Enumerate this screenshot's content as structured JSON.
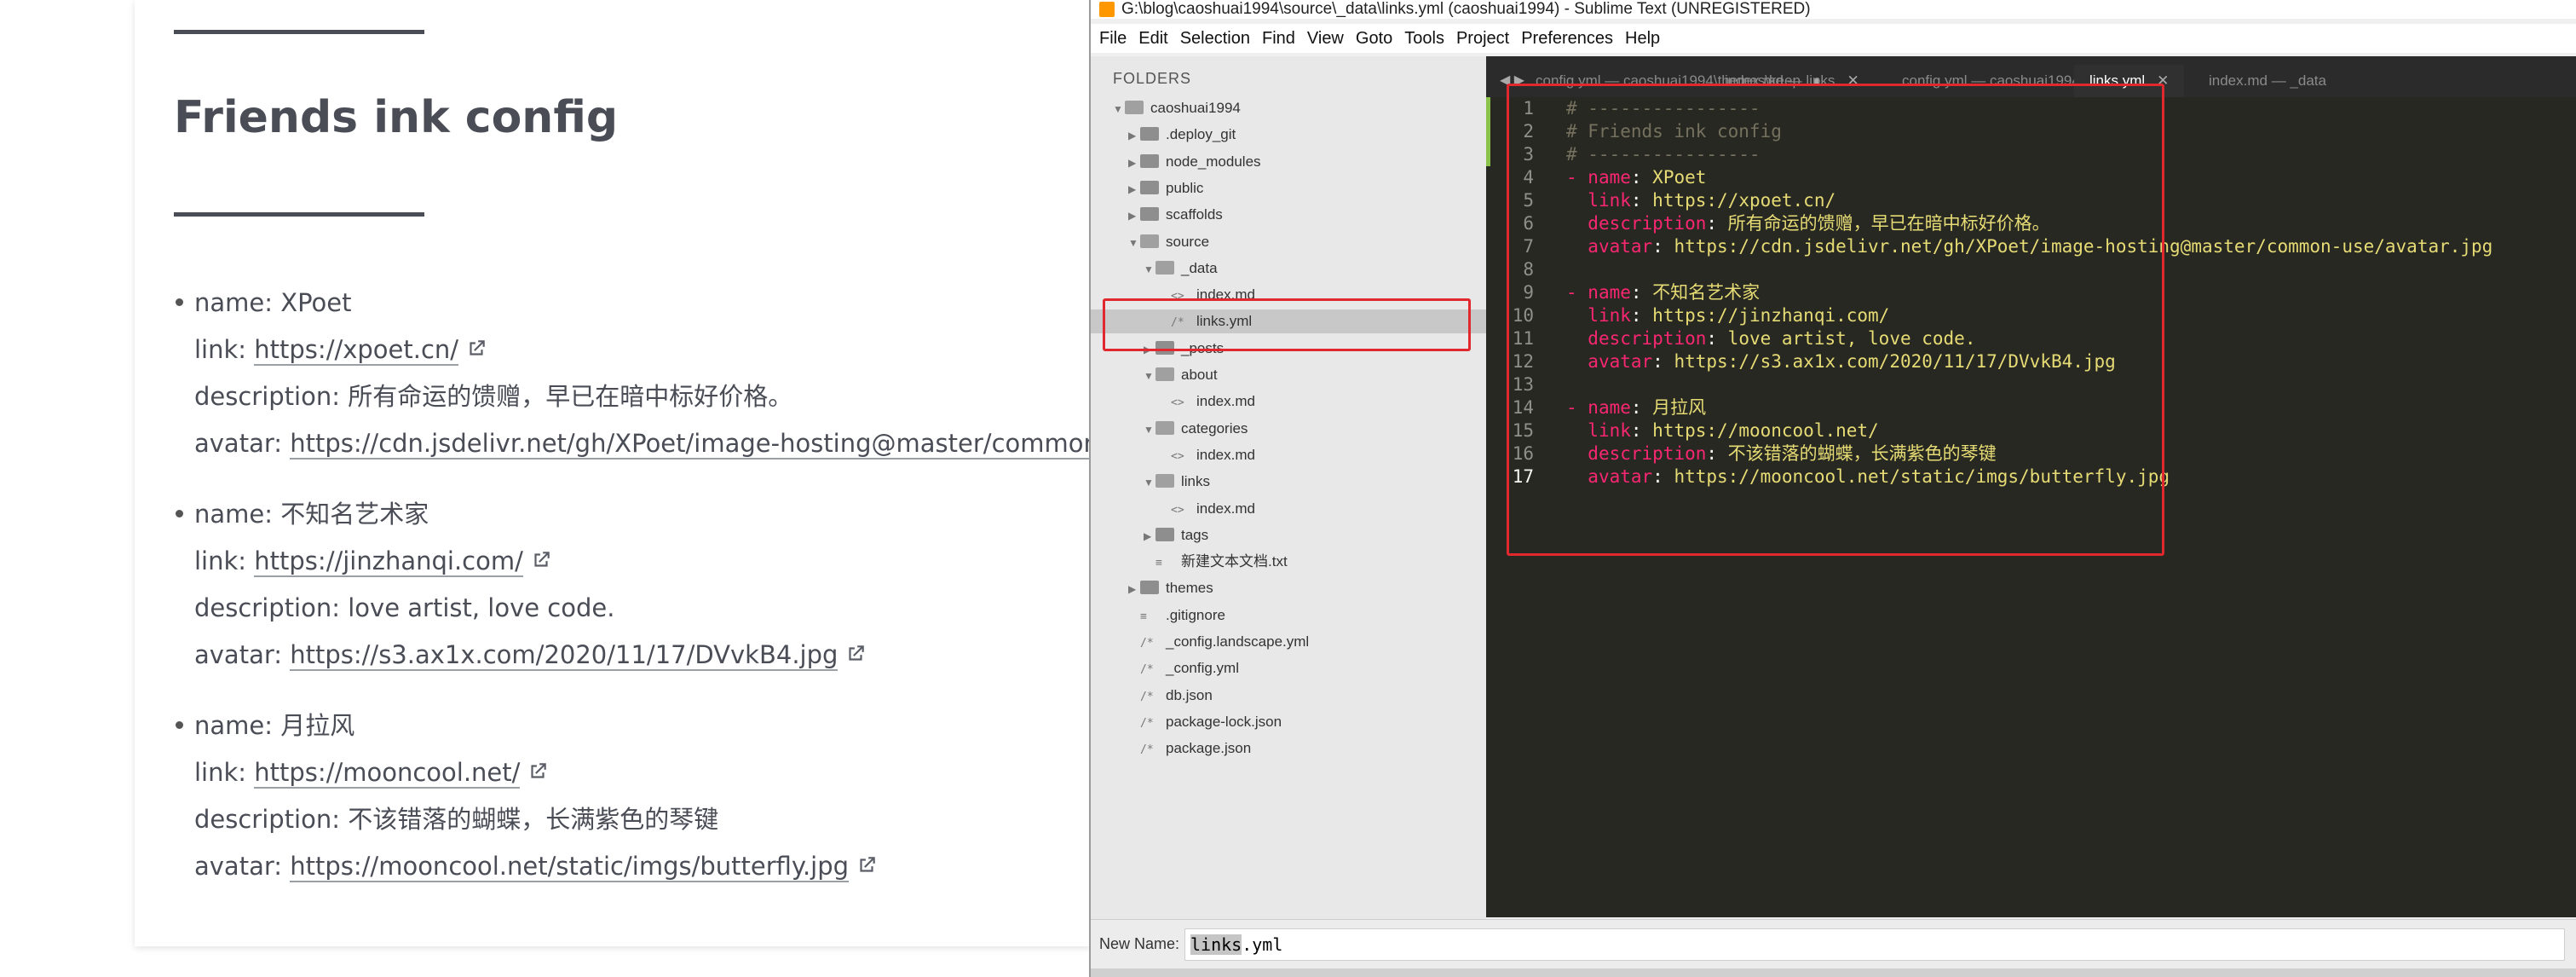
{
  "blog": {
    "heading": "Friends ink config",
    "entries": [
      {
        "name": "name: XPoet",
        "link_label": "link: ",
        "link": "https://xpoet.cn/",
        "description": "description: 所有命运的馈赠，早已在暗中标好价格。",
        "avatar_label": "avatar: ",
        "avatar": "https://cdn.jsdelivr.net/gh/XPoet/image-hosting@master/common-use/"
      },
      {
        "name": "name: 不知名艺术家",
        "link_label": "link: ",
        "link": "https://jinzhanqi.com/",
        "description": "description: love artist, love code.",
        "avatar_label": "avatar: ",
        "avatar": "https://s3.ax1x.com/2020/11/17/DVvkB4.jpg"
      },
      {
        "name": "name: 月拉风",
        "link_label": "link: ",
        "link": "https://mooncool.net/",
        "description": "description: 不该错落的蝴蝶，长满紫色的琴键",
        "avatar_label": "avatar: ",
        "avatar": "https://mooncool.net/static/imgs/butterfly.jpg"
      }
    ]
  },
  "sublime": {
    "title": "G:\\blog\\caoshuai1994\\source\\_data\\links.yml (caoshuai1994) - Sublime Text (UNREGISTERED)",
    "menu": [
      "File",
      "Edit",
      "Selection",
      "Find",
      "View",
      "Goto",
      "Tools",
      "Project",
      "Preferences",
      "Help"
    ],
    "sidebar": {
      "header": "FOLDERS",
      "items": [
        {
          "label": "caoshuai1994",
          "type": "folder-open"
        },
        {
          "label": ".deploy_git",
          "type": "folder"
        },
        {
          "label": "node_modules",
          "type": "folder"
        },
        {
          "label": "public",
          "type": "folder"
        },
        {
          "label": "scaffolds",
          "type": "folder"
        },
        {
          "label": "source",
          "type": "folder-open"
        },
        {
          "label": "_data",
          "type": "folder-open"
        },
        {
          "label": "index.md",
          "type": "file"
        },
        {
          "label": "links.yml",
          "type": "file"
        },
        {
          "label": "_posts",
          "type": "folder"
        },
        {
          "label": "about",
          "type": "folder-open"
        },
        {
          "label": "index.md",
          "type": "file"
        },
        {
          "label": "categories",
          "type": "folder-open"
        },
        {
          "label": "index.md",
          "type": "file"
        },
        {
          "label": "links",
          "type": "folder-open"
        },
        {
          "label": "index.md",
          "type": "file"
        },
        {
          "label": "tags",
          "type": "folder"
        },
        {
          "label": "新建文本文档.txt",
          "type": "file"
        },
        {
          "label": "themes",
          "type": "folder"
        },
        {
          "label": ".gitignore",
          "type": "file"
        },
        {
          "label": "_config.landscape.yml",
          "type": "file"
        },
        {
          "label": "_config.yml",
          "type": "file"
        },
        {
          "label": "db.json",
          "type": "file"
        },
        {
          "label": "package-lock.json",
          "type": "file"
        },
        {
          "label": "package.json",
          "type": "file"
        }
      ]
    },
    "tabs": [
      {
        "label": "config.yml — caoshuai1994\\themes\\keep",
        "marker": "●"
      },
      {
        "label": "index.md — links",
        "marker": "✕"
      },
      {
        "label": "config.yml — caoshuai1994",
        "marker": "●"
      },
      {
        "label": "links.yml",
        "marker": "✕"
      },
      {
        "label": "index.md — _data",
        "marker": ""
      }
    ],
    "code_lines": [
      "# ----------------",
      "# Friends ink config",
      "# ----------------",
      "- name: XPoet",
      "  link: https://xpoet.cn/",
      "  description: 所有命运的馈赠，早已在暗中标好价格。",
      "  avatar: https://cdn.jsdelivr.net/gh/XPoet/image-hosting@master/common-use/avatar.jpg",
      "",
      "- name: 不知名艺术家",
      "  link: https://jinzhanqi.com/",
      "  description: love artist, love code.",
      "  avatar: https://s3.ax1x.com/2020/11/17/DVvkB4.jpg",
      "",
      "- name: 月拉风",
      "  link: https://mooncool.net/",
      "  description: 不该错落的蝴蝶，长满紫色的琴键",
      "  avatar: https://mooncool.net/static/imgs/butterfly.jpg"
    ],
    "line_numbers": [
      "1",
      "2",
      "3",
      "4",
      "5",
      "6",
      "7",
      "8",
      "9",
      "10",
      "11",
      "12",
      "13",
      "14",
      "15",
      "16",
      "17"
    ],
    "rename": {
      "label": "New Name:",
      "selected": "links",
      "rest": ".yml"
    }
  },
  "colors": {
    "highlight_box": "#e0282e",
    "editor_bg": "#272822",
    "keyword": "#f92672",
    "string": "#e6db74",
    "comment": "#75715e"
  }
}
